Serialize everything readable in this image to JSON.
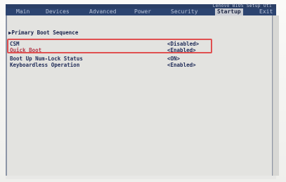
{
  "header": {
    "title": "Lenovo BIOS Setup Uti"
  },
  "menu": {
    "tabs": [
      {
        "label": "Main"
      },
      {
        "label": "Devices"
      },
      {
        "label": "Advanced"
      },
      {
        "label": "Power"
      },
      {
        "label": "Security"
      },
      {
        "label": "Startup"
      },
      {
        "label": "Exit"
      }
    ],
    "active_tab": "Startup"
  },
  "startup": {
    "primary_boot_sequence": "▶Primary Boot Sequence",
    "items": [
      {
        "label": "CSM",
        "value": "<Disabled>"
      },
      {
        "label": "Quick Boot",
        "value": "<Enabled>"
      },
      {
        "label": "Boot Up Num-Lock Status",
        "value": "<ON>"
      },
      {
        "label": "Keyboardless Operation",
        "value": "<Enabled>"
      }
    ]
  },
  "colors": {
    "menu_bar": "#2c4470",
    "highlight_box": "#e05050",
    "text": "#1f2b58"
  }
}
